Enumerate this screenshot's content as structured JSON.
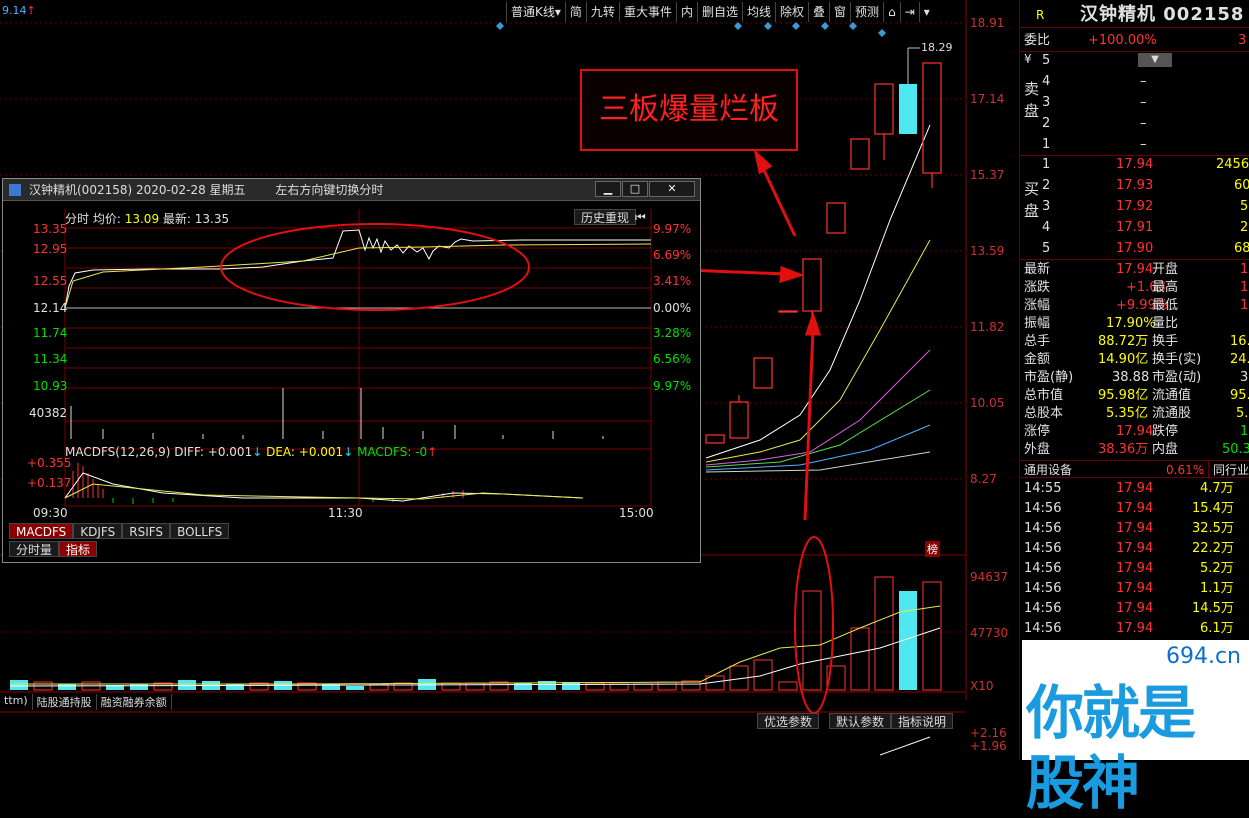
{
  "top_left_price": "9.14",
  "toolbar": [
    "普通K线",
    "简",
    "九转",
    "重大事件",
    "内",
    "删自选",
    "均线",
    "除权",
    "叠",
    "窗",
    "预测"
  ],
  "right_axis": [
    "18.91",
    "17.14",
    "15.37",
    "13.59",
    "11.82",
    "10.05",
    "8.27"
  ],
  "high_marker": "18.29",
  "volume_axis": [
    "94637",
    "47730",
    "X10"
  ],
  "indicator_axis": [
    "+2.16",
    "+1.96"
  ],
  "bottom_tabs": [
    "ttm)",
    "陆股通持股",
    "融资融券余额"
  ],
  "param_buttons": [
    "优选参数",
    "默认参数",
    "指标说明"
  ],
  "bang_label": "榜",
  "annotation": "三板爆量烂板",
  "colors": {
    "up": "#ff3232",
    "down": "#00e5ff",
    "grid": "#7a0000"
  },
  "popup": {
    "title": "汉钟精机(002158) 2020-02-28 星期五",
    "hint": "左右方向键切换分时",
    "legend_prefix": "分时",
    "avg_label": "均价:",
    "avg": "13.09",
    "last_label": "最新:",
    "last": "13.35",
    "history_btn": "历史重现",
    "left_prices": [
      "13.35",
      "12.95",
      "12.55",
      "12.14",
      "11.74",
      "11.34",
      "10.93"
    ],
    "right_pcts": [
      "9.97%",
      "6.69%",
      "3.41%",
      "0.00%",
      "3.28%",
      "6.56%",
      "9.97%"
    ],
    "vol_label": "40382",
    "macd_legend": "MACDFS(12,26,9)",
    "diff": "DIFF: +0.001",
    "dea": "DEA: +0.001",
    "macdfs": "MACDFS: -0",
    "macd_axis": [
      "+0.355",
      "+0.137"
    ],
    "times": [
      "09:30",
      "11:30",
      "15:00"
    ],
    "tabs": [
      "MACDFS",
      "KDJFS",
      "RSIFS",
      "BOLLFS"
    ],
    "subtabs": [
      "分时量",
      "指标"
    ]
  },
  "quote": {
    "badge": "R",
    "name": "汉钟精机 002158",
    "weibi_label": "委比",
    "weibi": "+100.00%",
    "weibi_extra": "3",
    "yen": "¥",
    "sell_label": [
      "卖",
      "盘"
    ],
    "buy_label": [
      "买",
      "盘"
    ],
    "sells": [
      {
        "n": "5",
        "p": "",
        "v": ""
      },
      {
        "n": "4",
        "p": "–",
        "v": ""
      },
      {
        "n": "3",
        "p": "–",
        "v": ""
      },
      {
        "n": "2",
        "p": "–",
        "v": ""
      },
      {
        "n": "1",
        "p": "–",
        "v": ""
      }
    ],
    "buys": [
      {
        "n": "1",
        "p": "17.94",
        "v": "2456"
      },
      {
        "n": "2",
        "p": "17.93",
        "v": "60"
      },
      {
        "n": "3",
        "p": "17.92",
        "v": "5"
      },
      {
        "n": "4",
        "p": "17.91",
        "v": "2"
      },
      {
        "n": "5",
        "p": "17.90",
        "v": "68"
      }
    ],
    "stats": [
      {
        "l1": "最新",
        "v1": "17.94",
        "l2": "开盘",
        "v2": "1"
      },
      {
        "l1": "涨跌",
        "v1": "+1.63",
        "l2": "最高",
        "v2": "1"
      },
      {
        "l1": "涨幅",
        "v1": "+9.99%",
        "l2": "最低",
        "v2": "1"
      },
      {
        "l1": "振幅",
        "v1": "17.90%",
        "l2": "量比",
        "v2": ""
      },
      {
        "l1": "总手",
        "v1": "88.72万",
        "l2": "换手",
        "v2": "16."
      },
      {
        "l1": "金额",
        "v1": "14.90亿",
        "l2": "换手(实)",
        "v2": "24."
      },
      {
        "l1": "市盈(静)",
        "v1": "38.88",
        "l2": "市盈(动)",
        "v2": "3"
      },
      {
        "l1": "总市值",
        "v1": "95.98亿",
        "l2": "流通值",
        "v2": "95.0"
      },
      {
        "l1": "总股本",
        "v1": "5.35亿",
        "l2": "流通股",
        "v2": "5.3"
      },
      {
        "l1": "涨停",
        "v1": "17.94",
        "l2": "跌停",
        "v2": "1"
      },
      {
        "l1": "外盘",
        "v1": "38.36万",
        "l2": "内盘",
        "v2": "50.3"
      }
    ],
    "sector_name": "通用设备",
    "sector_pct": "0.61%",
    "sector_rank": "同行业",
    "ticks": [
      {
        "t": "14:55",
        "p": "17.94",
        "v": "4.7万"
      },
      {
        "t": "14:56",
        "p": "17.94",
        "v": "15.4万"
      },
      {
        "t": "14:56",
        "p": "17.94",
        "v": "32.5万"
      },
      {
        "t": "14:56",
        "p": "17.94",
        "v": "22.2万"
      },
      {
        "t": "14:56",
        "p": "17.94",
        "v": "5.2万"
      },
      {
        "t": "14:56",
        "p": "17.94",
        "v": "1.1万"
      },
      {
        "t": "14:56",
        "p": "17.94",
        "v": "14.5万"
      },
      {
        "t": "14:56",
        "p": "17.94",
        "v": "6.1万"
      }
    ]
  },
  "watermark": {
    "site": "694.cn",
    "slogan": "你就是股神"
  }
}
